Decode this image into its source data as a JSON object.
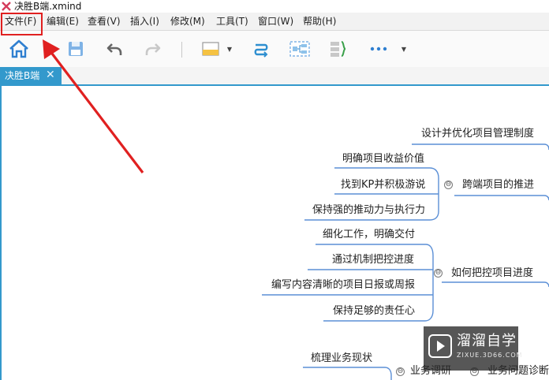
{
  "window": {
    "title": "决胜B端.xmind"
  },
  "menu": [
    "文件(F)",
    "编辑(E)",
    "查看(V)",
    "插入(I)",
    "修改(M)",
    "工具(T)",
    "窗口(W)",
    "帮助(H)"
  ],
  "toolbar": {
    "icons": [
      "home-icon",
      "save-icon",
      "undo-icon",
      "redo-icon",
      "topic-style-icon",
      "relationship-icon",
      "boundary-icon",
      "summary-icon",
      "more-icon"
    ],
    "dropdown_arrow": "▼"
  },
  "tab": {
    "label": "决胜B端",
    "close": "✕"
  },
  "mindmap": {
    "branch1": {
      "label": "跨端项目的推进",
      "collapse": "⊖",
      "children": [
        "明确项目收益价值",
        "找到KP并积极游说",
        "保持强的推动力与执行力"
      ]
    },
    "branch_top": {
      "label": "设计并优化项目管理制度"
    },
    "branch2": {
      "label": "如何把控项目进度",
      "collapse": "⊖",
      "children": [
        "细化工作，明确交付",
        "通过机制把控进度",
        "编写内容清晰的项目日报或周报",
        "保持足够的责任心"
      ]
    },
    "branch3": {
      "label": "业务调研",
      "collapse": "⊖",
      "children": [
        "梳理业务现状"
      ]
    },
    "branch4": {
      "label": "业务问题诊断",
      "collapse": "⊖"
    }
  },
  "watermark": {
    "title": "溜溜自学",
    "url": "ZIXUE.3D66.COM"
  },
  "colors": {
    "accent": "#3399cc",
    "annotation": "#e02020",
    "branch_line": "#5b8fd6"
  }
}
